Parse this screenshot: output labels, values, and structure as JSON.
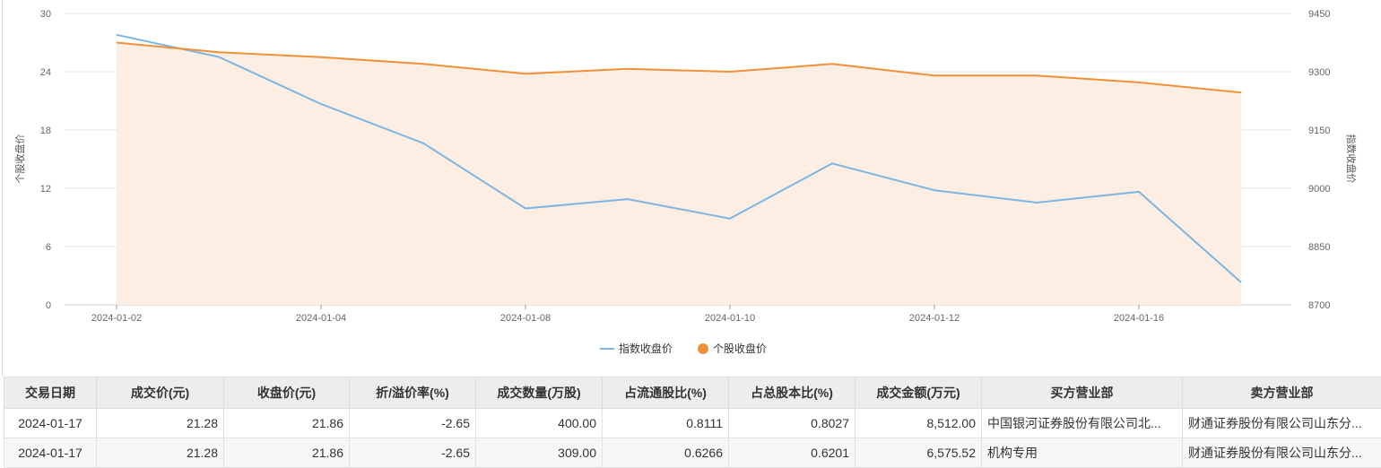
{
  "chart_data": {
    "type": "line",
    "x": [
      "2024-01-02",
      "2024-01-03",
      "2024-01-04",
      "2024-01-05",
      "2024-01-08",
      "2024-01-09",
      "2024-01-10",
      "2024-01-11",
      "2024-01-12",
      "2024-01-15",
      "2024-01-16",
      "2024-01-17"
    ],
    "x_tick_labels": [
      "2024-01-02",
      "2024-01-04",
      "2024-01-08",
      "2024-01-10",
      "2024-01-12",
      "2024-01-16"
    ],
    "y_left": {
      "label": "个股收盘价",
      "ylim": [
        0,
        30
      ],
      "ticks": [
        "0",
        "6",
        "12",
        "18",
        "24",
        "30"
      ]
    },
    "y_right": {
      "label": "指数收盘价",
      "ylim": [
        8700,
        9450
      ],
      "ticks": [
        "8700",
        "8850",
        "9000",
        "9150",
        "9300",
        "9450"
      ]
    },
    "series": [
      {
        "name": "指数收盘价",
        "axis": "right",
        "color": "#7cb5e2",
        "fill": false,
        "values": [
          9395,
          9338,
          9217,
          9116,
          8948,
          8972,
          8922,
          9064,
          8995,
          8963,
          8991,
          8758
        ]
      },
      {
        "name": "个股收盘价",
        "axis": "left",
        "color": "#f0913a",
        "fill": true,
        "fill_color": "#fdeee3",
        "values": [
          27.0,
          26.0,
          25.5,
          24.8,
          23.8,
          24.3,
          24.0,
          24.8,
          23.6,
          23.6,
          22.9,
          21.86
        ]
      }
    ],
    "grid": true,
    "legend_position": "bottom-center"
  },
  "table": {
    "headers": [
      "交易日期",
      "成交价(元)",
      "收盘价(元)",
      "折/溢价率(%)",
      "成交数量(万股)",
      "占流通股比(%)",
      "占总股本比(%)",
      "成交金额(万元)",
      "买方营业部",
      "卖方营业部"
    ],
    "rows": [
      [
        "2024-01-17",
        "21.28",
        "21.86",
        "-2.65",
        "400.00",
        "0.8111",
        "0.8027",
        "8,512.00",
        "中国银河证券股份有限公司北...",
        "财通证券股份有限公司山东分..."
      ],
      [
        "2024-01-17",
        "21.28",
        "21.86",
        "-2.65",
        "309.00",
        "0.6266",
        "0.6201",
        "6,575.52",
        "机构专用",
        "财通证券股份有限公司山东分..."
      ]
    ]
  }
}
